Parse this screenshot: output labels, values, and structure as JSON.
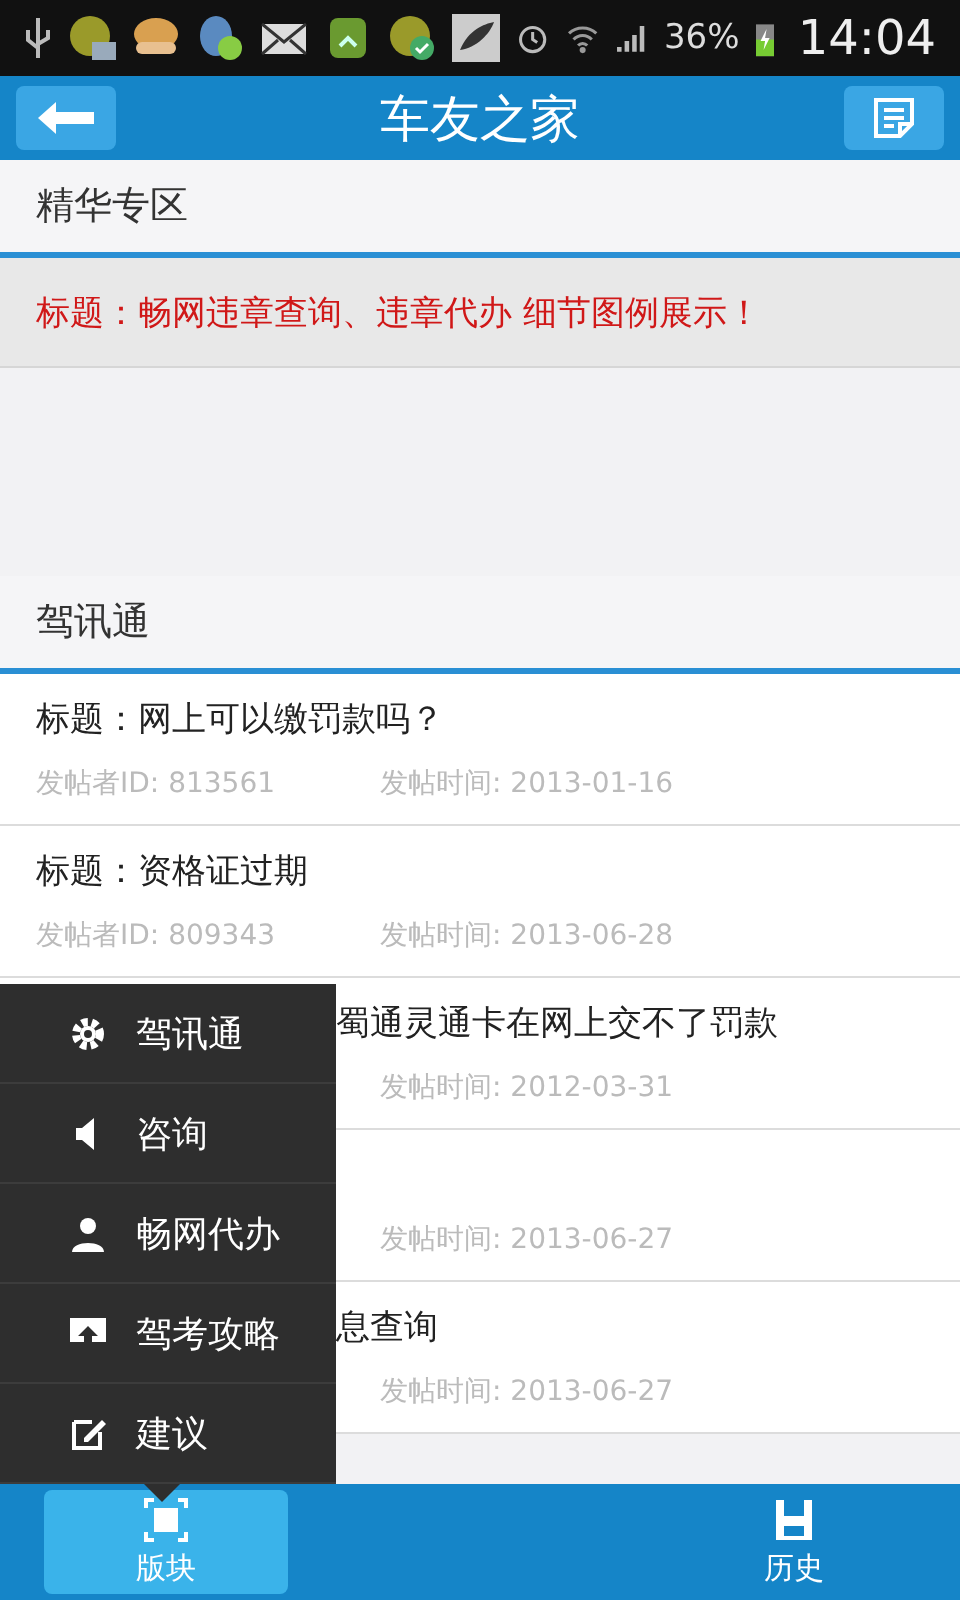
{
  "status_bar": {
    "battery_text": "36%",
    "time": "14:04"
  },
  "header": {
    "title": "车友之家"
  },
  "featured": {
    "title": "精华专区",
    "items": [
      {
        "title": "标题：畅网违章查询、违章代办 细节图例展示！"
      }
    ]
  },
  "section": {
    "title": "驾讯通",
    "rows": [
      {
        "title": "标题：网上可以缴罚款吗？",
        "poster": "发帖者ID: 813561",
        "time": "发帖时间: 2013-01-16",
        "covered": false
      },
      {
        "title": "标题：资格证过期",
        "poster": "发帖者ID: 809343",
        "time": "发帖时间: 2013-06-28",
        "covered": false
      },
      {
        "title": "蜀通灵通卡在网上交不了罚款",
        "time": "发帖时间: 2012-03-31",
        "covered": true
      },
      {
        "time": "发帖时间: 2013-06-27"
      },
      {
        "title": "息查询",
        "time": "发帖时间: 2013-06-27",
        "covered": true
      }
    ]
  },
  "menu": {
    "items": [
      {
        "kind": "gear",
        "label": "驾讯通"
      },
      {
        "kind": "speaker",
        "label": "咨询"
      },
      {
        "kind": "person",
        "label": "畅网代办"
      },
      {
        "kind": "upload",
        "label": "驾考攻略"
      },
      {
        "kind": "edit",
        "label": "建议"
      }
    ]
  },
  "tabs": [
    {
      "kind": "block",
      "label": "版块",
      "selected": true
    },
    {
      "kind": "history",
      "label": "历史",
      "selected": false
    }
  ]
}
